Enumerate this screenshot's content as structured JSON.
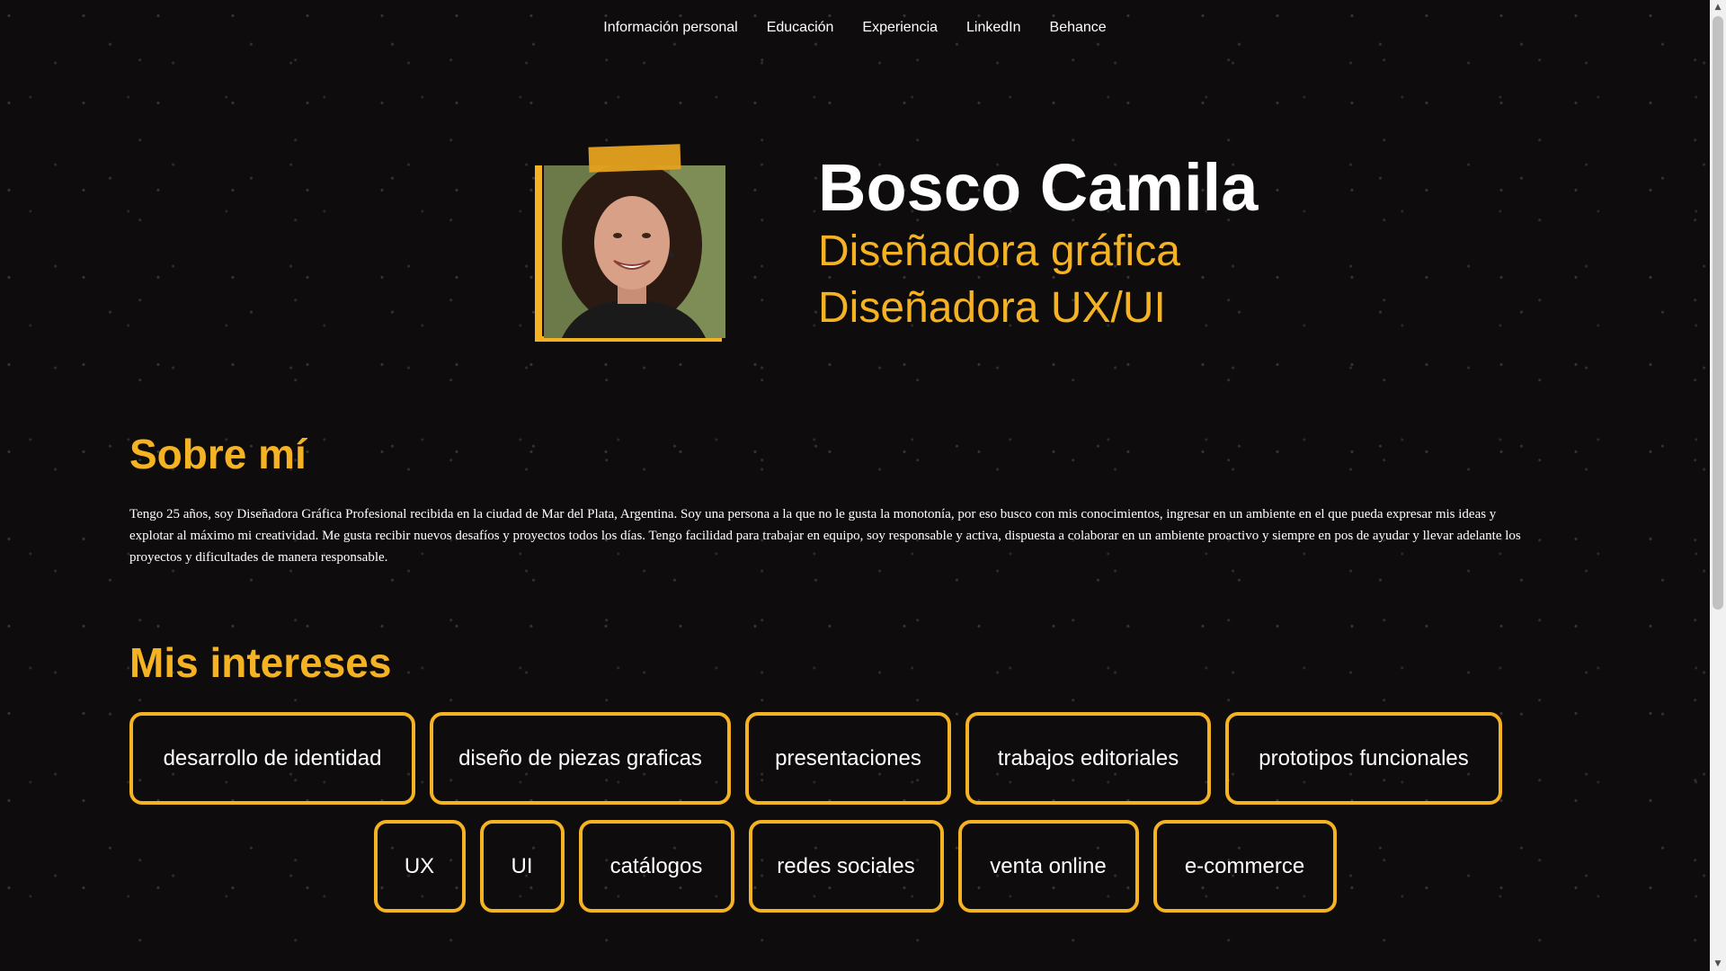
{
  "nav": {
    "items": [
      {
        "label": "Información personal"
      },
      {
        "label": "Educación"
      },
      {
        "label": "Experiencia"
      },
      {
        "label": "LinkedIn"
      },
      {
        "label": "Behance"
      }
    ]
  },
  "hero": {
    "name": "Bosco Camila",
    "role_1": "Diseñadora gráfica",
    "role_2": "Diseñadora UX/UI"
  },
  "about": {
    "title": "Sobre mí",
    "text": "Tengo 25 años, soy Diseñadora Gráfica Profesional recibida en la ciudad de Mar del Plata, Argentina. Soy una persona a la que no le gusta la monotonía, por eso busco con mis conocimientos, ingresar en un ambiente en el que pueda expresar mis ideas y explotar al máximo mi creatividad. Me gusta recibir nuevos desafíos y proyectos todos los días. Tengo facilidad para trabajar en equipo, soy responsable y activa, dispuesta a colaborar en un ambiente proactivo y siempre en pos de ayudar y llevar adelante los proyectos y dificultades de manera responsable."
  },
  "interests": {
    "title": "Mis intereses",
    "row_1": [
      "desarrollo de identidad",
      "diseño de piezas graficas",
      "presentaciones",
      "trabajos editoriales",
      "prototipos funcionales"
    ],
    "row_2": [
      "UX",
      "UI",
      "catálogos",
      "redes sociales",
      "venta online",
      "e-commerce"
    ]
  },
  "colors": {
    "background": "#0e0c0d",
    "accent": "#f5b324",
    "text": "#ffffff"
  },
  "icons": {
    "scroll_up": "scroll-up-arrow-icon",
    "scroll_down": "scroll-down-arrow-icon"
  }
}
